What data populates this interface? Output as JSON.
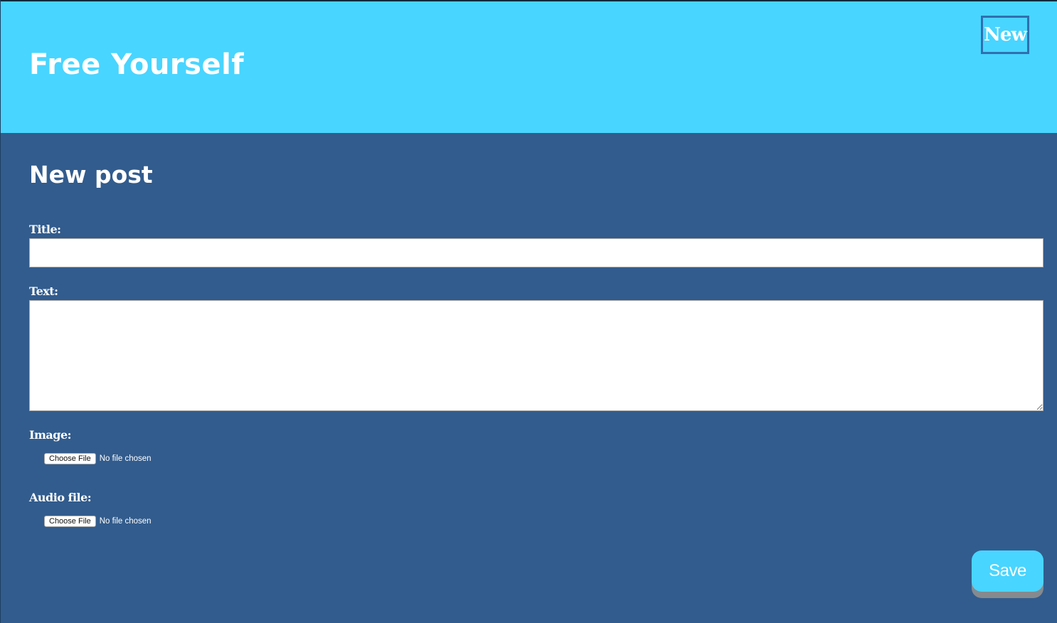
{
  "header": {
    "site_title": "Free Yourself",
    "new_link": "New"
  },
  "main": {
    "heading": "New post",
    "title_label": "Title:",
    "title_value": "",
    "text_label": "Text:",
    "text_value": "",
    "image_label": "Image:",
    "image_button": "Choose File",
    "image_status": "No file chosen",
    "audio_label": "Audio file:",
    "audio_button": "Choose File",
    "audio_status": "No file chosen",
    "save_label": "Save"
  },
  "colors": {
    "header_bg": "#48d5ff",
    "page_bg": "#325c8d",
    "button_accent": "#48d5ff",
    "new_link_border": "#2f6fb0"
  }
}
